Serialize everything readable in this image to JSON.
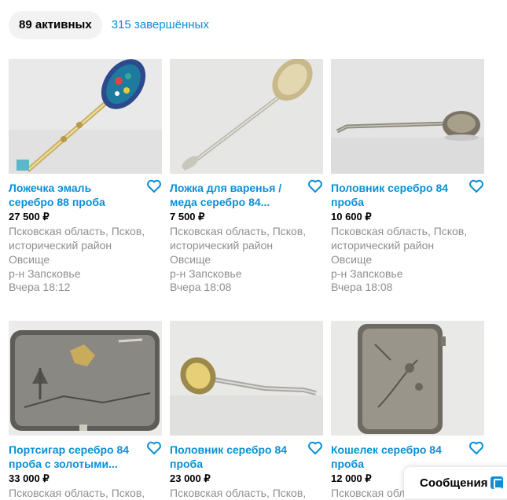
{
  "tabs": {
    "active_label": "89 активных",
    "inactive_label": "315 завершённых"
  },
  "listings": [
    {
      "title_line1": "Ложечка эмаль",
      "title_line2": "серебро 88 проба",
      "price": "27 500 ₽",
      "location_line1": "Псковская область, Псков,",
      "location_line2": "исторический район",
      "location_line3": "Овсище",
      "location_line4": "р-н Запсковье",
      "date": "Вчера 18:12"
    },
    {
      "title_line1": "Ложка для варенья /",
      "title_line2": "меда серебро 84...",
      "price": "7 500 ₽",
      "location_line1": "Псковская область, Псков,",
      "location_line2": "исторический район",
      "location_line3": "Овсище",
      "location_line4": "р-н Запсковье",
      "date": "Вчера 18:08"
    },
    {
      "title_line1": "Половник серебро 84",
      "title_line2": "проба",
      "price": "10 600 ₽",
      "location_line1": "Псковская область, Псков,",
      "location_line2": "исторический район",
      "location_line3": "Овсище",
      "location_line4": "р-н Запсковье",
      "date": "Вчера 18:08"
    },
    {
      "title_line1": "Портсигар серебро 84",
      "title_line2": "проба с золотыми...",
      "price": "33 000 ₽",
      "location_line1": "Псковская область, Псков,"
    },
    {
      "title_line1": "Половник серебро 84",
      "title_line2": "проба",
      "price": "23 000 ₽",
      "location_line1": "Псковская область, Псков,"
    },
    {
      "title_line1": "Кошелек серебро 84",
      "title_line2": "проба",
      "price": "12 000 ₽",
      "location_line1": "Псковская область, Псков,"
    }
  ],
  "messages": {
    "label": "Сообщения",
    "icon": "messenger-icon"
  },
  "colors": {
    "link": "#0a8fd6",
    "muted": "#8f8f8f",
    "tab_bg": "#f2f2f2"
  }
}
